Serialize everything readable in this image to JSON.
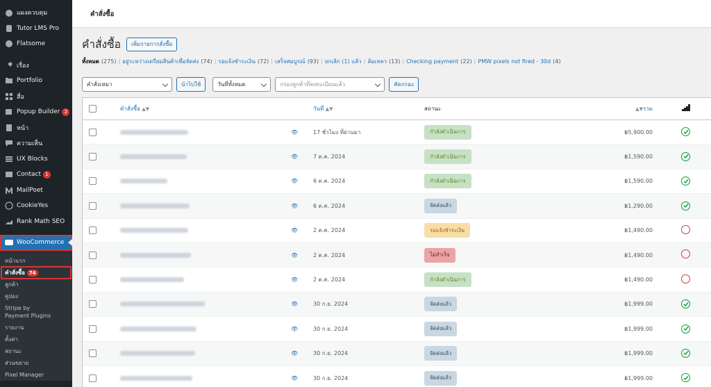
{
  "sidebar": {
    "items": [
      {
        "label": "แผงควบคุม",
        "icon": "dashboard-icon"
      },
      {
        "label": "Tutor LMS Pro",
        "icon": "tutor-icon"
      },
      {
        "label": "Flatsome",
        "icon": "flatsome-icon"
      },
      {
        "label": "เรื่อง",
        "icon": "pin-icon"
      },
      {
        "label": "Portfolio",
        "icon": "folder-icon"
      },
      {
        "label": "สื่อ",
        "icon": "media-icon"
      },
      {
        "label": "Popup Builder",
        "icon": "popup-icon",
        "badge": "2"
      },
      {
        "label": "หน้า",
        "icon": "page-icon"
      },
      {
        "label": "ความเห็น",
        "icon": "comment-icon"
      },
      {
        "label": "UX Blocks",
        "icon": "blocks-icon"
      },
      {
        "label": "Contact",
        "icon": "mail-icon",
        "badge": "1"
      },
      {
        "label": "MailPoet",
        "icon": "mailpoet-icon"
      },
      {
        "label": "CookieYes",
        "icon": "cookie-icon"
      },
      {
        "label": "Rank Math SEO",
        "icon": "rankmath-icon"
      },
      {
        "label": "WooCommerce",
        "icon": "woo-icon"
      }
    ],
    "submenu": [
      {
        "label": "หน้าแรก"
      },
      {
        "label": "คำสั่งซื้อ",
        "badge": "74"
      },
      {
        "label": "ลูกค้า"
      },
      {
        "label": "คูปอง"
      },
      {
        "label": "Stripe by"
      },
      {
        "label": "Payment Plugins"
      },
      {
        "label": "รายงาน"
      },
      {
        "label": "ตั้งค่า"
      },
      {
        "label": "สถานะ"
      },
      {
        "label": "ส่วนขยาย"
      },
      {
        "label": "Pixel Manager"
      }
    ]
  },
  "topbar": {
    "title": "คำสั่งซื้อ"
  },
  "page": {
    "title": "คำสั่งซื้อ",
    "add_button": "เพิ่มรายการสั่งซื้อ"
  },
  "filters_links": [
    {
      "label": "ทั้งหมด",
      "count": "(275)"
    },
    {
      "label": "อยู่ระหว่างเตรียมสินค้าเพื่อจัดส่ง",
      "count": "(74)"
    },
    {
      "label": "รอแจ้งชำระเงิน",
      "count": "(72)"
    },
    {
      "label": "เสร็จสมบูรณ์",
      "count": "(93)"
    },
    {
      "label": "ยกเลิก (1) แล้ว",
      "count": ""
    },
    {
      "label": "ล้มเหลว",
      "count": "(13)"
    },
    {
      "label": "Checking payment",
      "count": "(22)"
    },
    {
      "label": "PMW pixels not fired - 30d",
      "count": "(4)"
    }
  ],
  "toolbar": {
    "bulk_action": "คำสั่งเหมา",
    "apply": "นำไปใช้",
    "date_filter": "วันที่ทั้งหมด",
    "customer_placeholder": "กรองลูกค้าที่ลงทะเบียนแล้ว",
    "filter_button": "คัดกรอง"
  },
  "table": {
    "headers": {
      "order": "คำสั่งซื้อ",
      "date": "วันที่",
      "status": "สถานะ",
      "total": "รวม"
    },
    "rows": [
      {
        "date": "17 ชั่วโมง ที่ผ่านมา",
        "status": "กำลังดำเนินการ",
        "status_type": "proc",
        "total": "฿5,900.00",
        "check": "ok"
      },
      {
        "date": "7 ต.ค. 2024",
        "status": "กำลังดำเนินการ",
        "status_type": "proc",
        "total": "฿1,590.00",
        "check": "ok"
      },
      {
        "date": "6 ต.ค. 2024",
        "status": "กำลังดำเนินการ",
        "status_type": "proc",
        "total": "฿1,590.00",
        "check": "ok"
      },
      {
        "date": "6 ต.ค. 2024",
        "status": "จัดส่งแล้ว",
        "status_type": "done",
        "total": "฿1,290.00",
        "check": "ok"
      },
      {
        "date": "2 ต.ค. 2024",
        "status": "รอแจ้งชำระเงิน",
        "status_type": "hold",
        "total": "฿1,490.00",
        "check": "no"
      },
      {
        "date": "2 ต.ค. 2024",
        "status": "ไม่สำเร็จ",
        "status_type": "fail",
        "total": "฿1,490.00",
        "check": "no"
      },
      {
        "date": "2 ต.ค. 2024",
        "status": "กำลังดำเนินการ",
        "status_type": "proc",
        "total": "฿1,490.00",
        "check": "no"
      },
      {
        "date": "30 ก.ย. 2024",
        "status": "จัดส่งแล้ว",
        "status_type": "done",
        "total": "฿1,999.00",
        "check": "ok"
      },
      {
        "date": "30 ก.ย. 2024",
        "status": "จัดส่งแล้ว",
        "status_type": "done",
        "total": "฿1,999.00",
        "check": "ok"
      },
      {
        "date": "30 ก.ย. 2024",
        "status": "จัดส่งแล้ว",
        "status_type": "done",
        "total": "฿1,999.00",
        "check": "ok"
      },
      {
        "date": "30 ก.ย. 2024",
        "status": "จัดส่งแล้ว",
        "status_type": "done",
        "total": "฿1,999.00",
        "check": "ok"
      }
    ]
  }
}
